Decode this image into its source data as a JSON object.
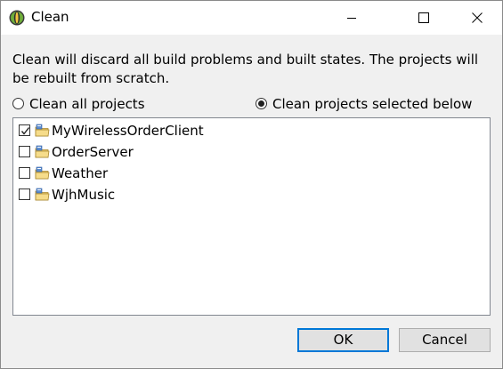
{
  "window": {
    "title": "Clean"
  },
  "message": "Clean will discard all build problems and built states.  The projects will be rebuilt from scratch.",
  "options": {
    "clean_all_label": "Clean all projects",
    "clean_all_selected": false,
    "clean_selected_label": "Clean projects selected below",
    "clean_selected_selected": true
  },
  "projects": [
    {
      "name": "MyWirelessOrderClient",
      "checked": true
    },
    {
      "name": "OrderServer",
      "checked": false
    },
    {
      "name": "Weather",
      "checked": false
    },
    {
      "name": "WjhMusic",
      "checked": false
    }
  ],
  "buttons": {
    "ok_label": "OK",
    "cancel_label": "Cancel"
  },
  "icons": {
    "app": "eclipse-icon",
    "project": "project-folder-icon",
    "minimize": "minimize-icon",
    "maximize": "maximize-icon",
    "close": "close-icon"
  },
  "colors": {
    "default_button_border": "#0078d7",
    "dialog_background": "#f0f0f0"
  }
}
